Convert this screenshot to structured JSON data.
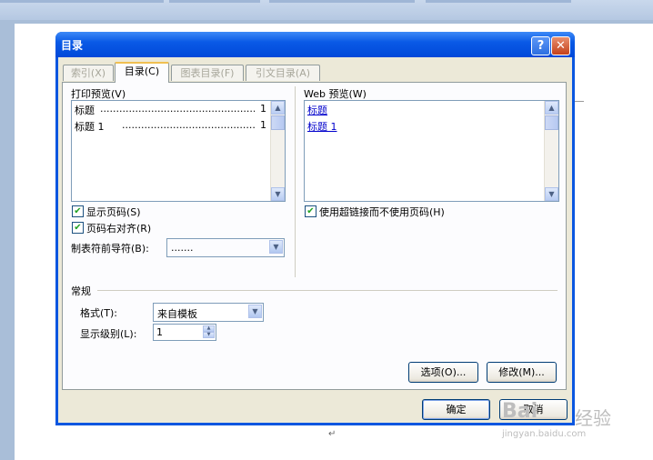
{
  "dialog": {
    "title": "目录",
    "help": "?",
    "close": "✕"
  },
  "tabs": [
    {
      "label": "索引(X)",
      "active": false
    },
    {
      "label": "目录(C)",
      "active": true
    },
    {
      "label": "图表目录(F)",
      "active": false
    },
    {
      "label": "引文目录(A)",
      "active": false
    }
  ],
  "print_preview": {
    "label": "打印预览(V)",
    "lines": [
      {
        "text": "标题",
        "page": "1"
      },
      {
        "text": "标题  1",
        "page": "1"
      }
    ],
    "dots": "..............................................................."
  },
  "web_preview": {
    "label": "Web 预览(W)",
    "links": [
      "标题",
      "标题 1"
    ]
  },
  "options": {
    "show_page_numbers": {
      "label": "显示页码(S)",
      "checked": true
    },
    "right_align": {
      "label": "页码右对齐(R)",
      "checked": true
    },
    "tab_leader_label": "制表符前导符(B):",
    "tab_leader_value": ".......",
    "use_hyperlinks": {
      "label": "使用超链接而不使用页码(H)",
      "checked": true
    }
  },
  "general": {
    "section_label": "常规",
    "format_label": "格式(T):",
    "format_value": "来自模板",
    "levels_label": "显示级别(L):",
    "levels_value": "1"
  },
  "buttons": {
    "options": "选项(O)...",
    "modify": "修改(M)...",
    "ok": "确定",
    "cancel": "取消"
  },
  "watermark": {
    "main": "Bai",
    "cn": "经验",
    "sub": "jingyan.baidu.com"
  },
  "paragraph_mark": "↵",
  "colors": {
    "title_bar": "#0a5ae6",
    "dialog_face": "#ece9d8",
    "link": "#0000cc",
    "checkmark": "#21a121"
  }
}
